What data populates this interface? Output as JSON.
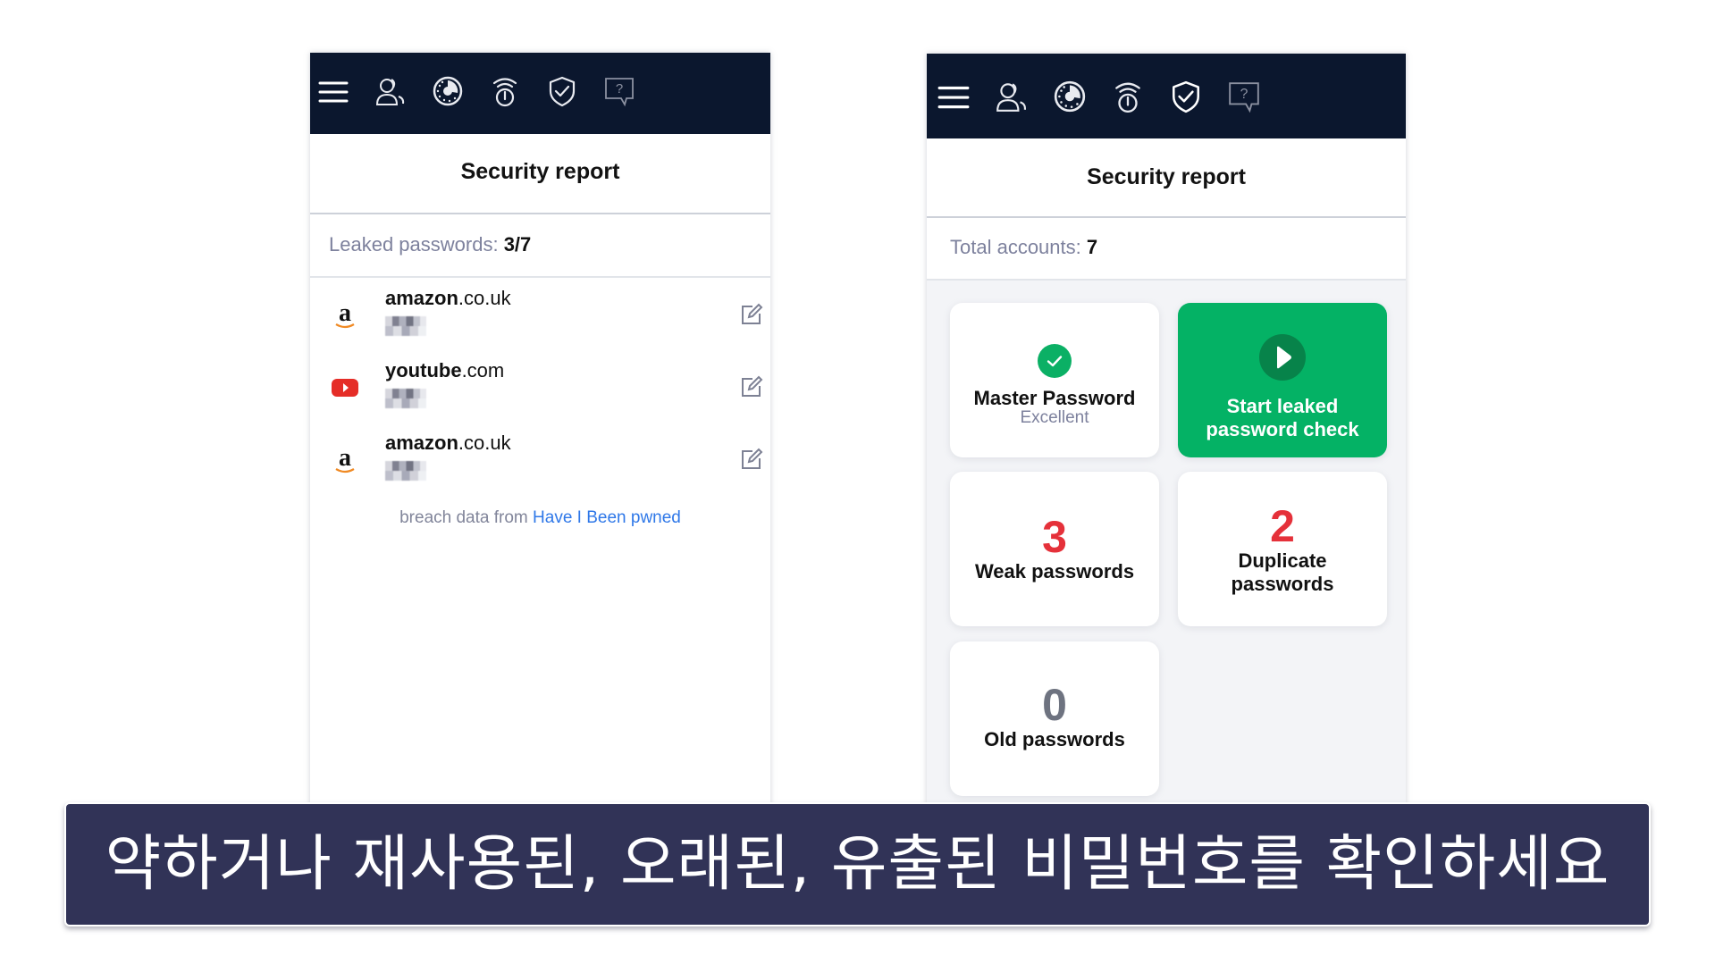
{
  "toolbar_icons": [
    "menu-icon",
    "accounts-icon",
    "dashboard-icon",
    "vpn-icon",
    "security-shield-icon",
    "help-icon"
  ],
  "left_panel": {
    "title": "Security report",
    "stat_label": "Leaked passwords:",
    "stat_value": "3/7",
    "items": [
      {
        "logo": "amazon-logo",
        "domain_base": "amazon",
        "domain_suffix": ".co.uk",
        "username": "masked"
      },
      {
        "logo": "youtube-logo",
        "domain_base": "youtube",
        "domain_suffix": ".com",
        "username": "masked"
      },
      {
        "logo": "amazon-logo",
        "domain_base": "amazon",
        "domain_suffix": ".co.uk",
        "username": "masked"
      }
    ],
    "footnote_prefix": "breach data from",
    "footnote_link": "Have I Been pwned"
  },
  "right_panel": {
    "title": "Security report",
    "stat_label": "Total accounts:",
    "stat_value": "7",
    "cards": {
      "master": {
        "title": "Master Password",
        "status": "Excellent",
        "icon": "check-circle-icon"
      },
      "leak_check": {
        "title_line1": "Start leaked",
        "title_line2": "password check",
        "icon": "play-icon"
      },
      "weak": {
        "count": "3",
        "label": "Weak passwords"
      },
      "duplicate": {
        "count": "2",
        "label_line1": "Duplicate",
        "label_line2": "passwords"
      },
      "old": {
        "count": "0",
        "label": "Old passwords"
      }
    }
  },
  "colors": {
    "header_bg": "#0b172e",
    "accent_green": "#04b265",
    "alert_red": "#e5313a",
    "link_blue": "#2f78e8",
    "caption_bg": "#313357"
  },
  "caption": "약하거나 재사용된, 오래된, 유출된 비밀번호를 확인하세요"
}
